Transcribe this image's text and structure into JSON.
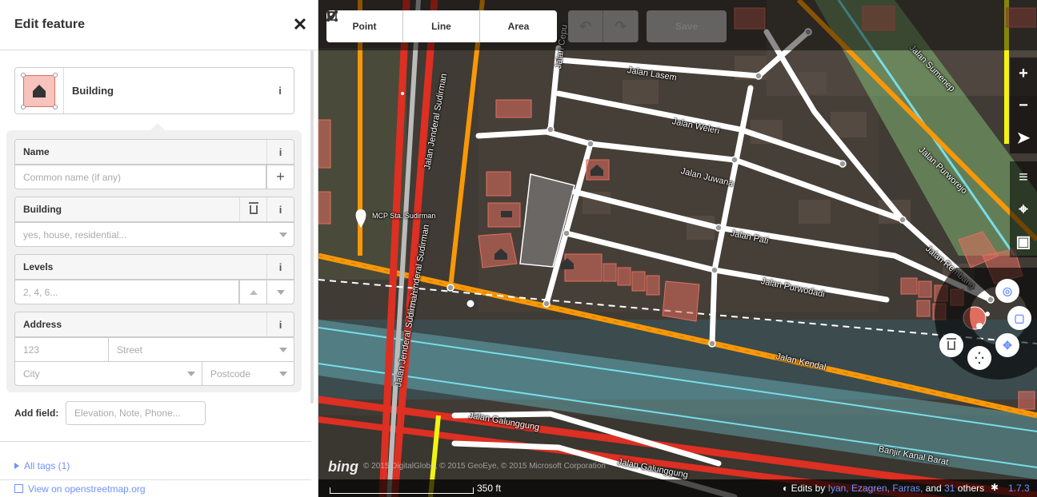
{
  "sidebar": {
    "title": "Edit feature",
    "close_glyph": "✕",
    "preset": {
      "label": "Building",
      "icon": "building-icon",
      "info_glyph": "i"
    },
    "fields": {
      "name": {
        "label": "Name",
        "placeholder": "Common name (if any)",
        "add_glyph": "+"
      },
      "building": {
        "label": "Building",
        "placeholder": "yes, house, residential..."
      },
      "levels": {
        "label": "Levels",
        "placeholder": "2, 4, 6..."
      },
      "address": {
        "label": "Address",
        "housenumber_placeholder": "123",
        "street_placeholder": "Street",
        "city_placeholder": "City",
        "postcode_placeholder": "Postcode"
      }
    },
    "add_field": {
      "label": "Add field:",
      "placeholder": "Elevation, Note, Phone..."
    },
    "all_tags": "All tags (1)",
    "view_osm": "View on openstreetmap.org"
  },
  "toolbar": {
    "point": "Point",
    "line": "Line",
    "area": "Area",
    "undo_glyph": "↶",
    "redo_glyph": "↷",
    "save": "Save"
  },
  "map_controls": [
    "+",
    "−",
    "➤",
    "≡",
    "⌖",
    "▣"
  ],
  "map_labels": {
    "jalan_lasem": "Jalan Lasem",
    "jalan_weleri": "Jalan Weleri",
    "jalan_juwana": "Jalan Juwana",
    "jalan_pati": "Jalan Pati",
    "jalan_purwodadi": "Jalan Purwodadi",
    "jalan_kendal": "Jalan Kendal",
    "jalan_galunggung_1": "Jalan Galunggung",
    "jalan_galunggung_2": "Jalan Galunggung",
    "banjir": "Banjir Kanal Barat",
    "sumenep": "Jalan Sumenep",
    "purworejo": "Jalan Purworejo",
    "rembang": "Jalan Rembang",
    "sudirman_1": "Jalan Jenderal Sudirman",
    "sudirman_2": "Jalan Jenderal Sudirman",
    "sudirman_3": "Jalan Jenderal Sudirman",
    "cepu": "Jalan Cepu",
    "mcp": "MCP Sta. Sudirman"
  },
  "footer": {
    "bing": "bing",
    "imagery": "© 2015 DigitalGlobe, © 2015 GeoEye, © 2015 Microsoft Corporation",
    "scale": "350 ft",
    "edits_prefix": "Edits by",
    "editors": "Iyan, Ezagren, Farras,",
    "and": "and",
    "others_count": "31",
    "others": "others",
    "version": "1.7.3"
  },
  "colors": {
    "accent": "#7092ff",
    "building_fill": "#e06e5f",
    "road_primary": "#f99806",
    "road_trunk": "#dd2f22",
    "road_secondary": "#f3f312",
    "waterway": "#77dde7"
  }
}
